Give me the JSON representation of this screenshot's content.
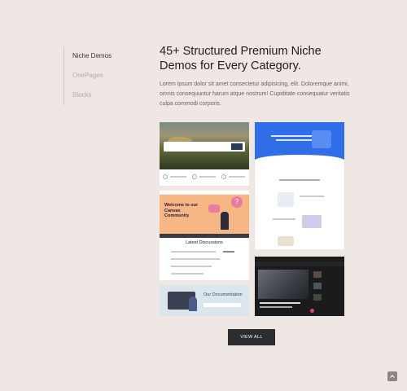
{
  "nav": {
    "items": [
      {
        "label": "Niche Demos"
      },
      {
        "label": "OnePages"
      },
      {
        "label": "Blocks"
      }
    ]
  },
  "heading": "45+ Structured Premium Niche Demos for Every Category.",
  "description": "Lorem ipsum dolor sit amet consectetur adipisicing, elit. Doloremque animi, omnis consequuntur harum atque nostrum! Cupiditate consequatur veritatis culpa commodi corporis.",
  "previews": {
    "community": {
      "title": "Welcome to our Canvas Community"
    },
    "discussions": {
      "title": "Latest Discussions"
    },
    "documentation": {
      "title": "Our Documentation"
    }
  },
  "view_all_label": "VIEW ALL",
  "colors": {
    "background": "#efe7e3",
    "button": "#2c2d31",
    "accent_blue": "#2f6ee8",
    "accent_orange": "#f7b785",
    "accent_pink": "#ec7ba1"
  },
  "icons": {
    "scroll_top": "chevron-up-icon"
  }
}
